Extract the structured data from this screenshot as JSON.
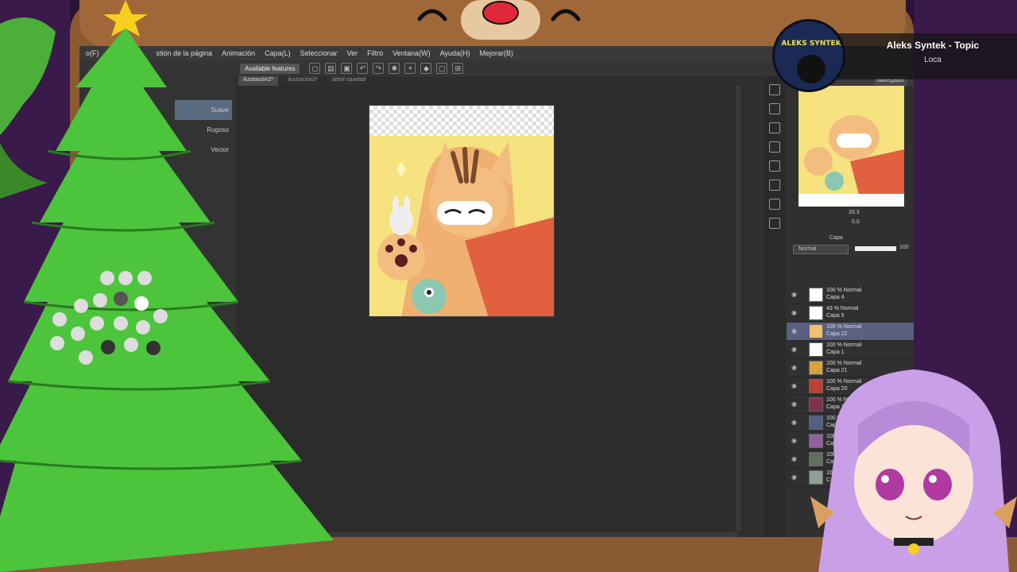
{
  "app": {
    "menu": [
      "o(F)",
      "stión de la página",
      "Animación",
      "Capa(L)",
      "Seleccionar",
      "Ver",
      "Filtro",
      "Ventana(W)",
      "Ayuda(H)",
      "Mejorar(B)"
    ],
    "available_features": "Available features",
    "tabs": [
      "ilustración2*",
      "ilustración3*",
      "arbol navidad"
    ],
    "brushes": [
      "Suave",
      "Rugoso",
      "Vector"
    ]
  },
  "navigator": {
    "tab_label": "Navegador",
    "zoom": "33.3",
    "rotation": "0.0"
  },
  "layer_panel": {
    "tab_label": "Capa",
    "blend_mode": "Normal",
    "opacity": "100",
    "layers": [
      {
        "opacity": "100 % Normal",
        "name": "Capa 4",
        "selected": false,
        "thumb": "#ffffff"
      },
      {
        "opacity": "43 % Normal",
        "name": "Capa 5",
        "selected": false,
        "thumb": "#ffffff"
      },
      {
        "opacity": "100 % Normal",
        "name": "Capa 22",
        "selected": true,
        "thumb": "#f0c070"
      },
      {
        "opacity": "100 % Normal",
        "name": "Capa 1",
        "selected": false,
        "thumb": "#ffffff"
      },
      {
        "opacity": "100 % Normal",
        "name": "Capa 21",
        "selected": false,
        "thumb": "#d9a040"
      },
      {
        "opacity": "100 % Normal",
        "name": "Capa 20",
        "selected": false,
        "thumb": "#c04030"
      },
      {
        "opacity": "100 % Normal",
        "name": "Capa 19",
        "selected": false,
        "thumb": "#803050"
      },
      {
        "opacity": "100 % Norm",
        "name": "Capa 18",
        "selected": false,
        "thumb": "#506080"
      },
      {
        "opacity": "100 % N",
        "name": "Capa 1",
        "selected": false,
        "thumb": "#9060a0"
      },
      {
        "opacity": "100 %",
        "name": "Cap",
        "selected": false,
        "thumb": "#607060"
      },
      {
        "opacity": "10",
        "name": "C",
        "selected": false,
        "thumb": "#90a090"
      }
    ]
  },
  "music": {
    "title": "Aleks Syntek - Topic",
    "artist": "Loca",
    "album_art_text": "ALEKS SYNTEK"
  }
}
